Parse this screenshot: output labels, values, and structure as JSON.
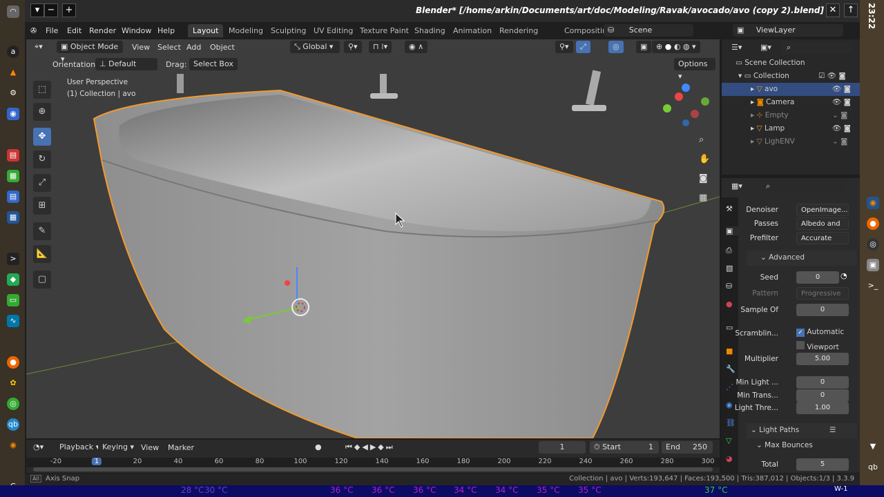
{
  "window": {
    "title": "Blender* [/home/arkin/Documents/art/doc/Modeling/Ravak/avocado/avo (copy 2).blend]",
    "clock": "23:22"
  },
  "menu": [
    "File",
    "Edit",
    "Render",
    "Window",
    "Help"
  ],
  "workspaces": [
    "Layout",
    "Modeling",
    "Sculpting",
    "UV Editing",
    "Texture Paint",
    "Shading",
    "Animation",
    "Rendering",
    "Compositing"
  ],
  "scene": {
    "label": "Scene",
    "view_layer": "ViewLayer"
  },
  "viewport_header": {
    "mode": "Object Mode",
    "menus": [
      "View",
      "Select",
      "Add",
      "Object"
    ],
    "transform": "Global",
    "orientation_label": "Orientation:",
    "orientation": "Default",
    "drag_label": "Drag:",
    "drag": "Select Box",
    "options": "Options"
  },
  "viewport": {
    "perspective": "User Perspective",
    "collection": "(1) Collection | avo"
  },
  "outliner": {
    "root": "Scene Collection",
    "collection": "Collection",
    "items": [
      "avo",
      "Camera",
      "Empty",
      "Lamp",
      "LighENV"
    ]
  },
  "properties": {
    "denoiser": {
      "label": "Denoiser",
      "value": "OpenImage..."
    },
    "passes": {
      "label": "Passes",
      "value": "Albedo and ..."
    },
    "prefilter": {
      "label": "Prefilter",
      "value": "Accurate"
    },
    "advanced": "Advanced",
    "seed": {
      "label": "Seed",
      "value": "0"
    },
    "pattern": {
      "label": "Pattern",
      "value": "Progressive ..."
    },
    "sample_offset": {
      "label": "Sample Of",
      "value": "0"
    },
    "scrambling": {
      "label": "Scramblin...",
      "automatic": "Automatic",
      "automatic_checked": true,
      "viewport": "Viewport",
      "viewport_checked": false
    },
    "multiplier": {
      "label": "Multiplier",
      "value": "5.00"
    },
    "min_light": {
      "label": "Min Light ...",
      "value": "0"
    },
    "min_trans": {
      "label": "Min Trans...",
      "value": "0"
    },
    "light_threshold": {
      "label": "Light Thre...",
      "value": "1.00"
    },
    "light_paths": "Light Paths",
    "max_bounces": "Max Bounces",
    "total": {
      "label": "Total",
      "value": "5"
    }
  },
  "timeline": {
    "menus": [
      "Playback",
      "Keying",
      "View",
      "Marker"
    ],
    "current_frame": "1",
    "start_label": "Start",
    "start": "1",
    "end_label": "End",
    "end": "250",
    "ticks": [
      "-20",
      "1",
      "20",
      "40",
      "60",
      "80",
      "100",
      "120",
      "140",
      "160",
      "180",
      "200",
      "220",
      "240",
      "260",
      "280",
      "300"
    ]
  },
  "statusbar": {
    "left": "Axis Snap",
    "right": "Collection | avo | Verts:193,647 | Faces:193,500 | Tris:387,012 | Objects:1/3 | 3.3.9"
  },
  "sysbar": {
    "temps": [
      "28 °C",
      "30 °C",
      "36 °C",
      "36 °C",
      "36 °C",
      "34 °C",
      "34 °C",
      "35 °C",
      "35 °C",
      "37 °C"
    ],
    "workspace": "W-1"
  },
  "colors": {
    "accent": "#4772b3",
    "selection_outline": "#f39a2e",
    "sysbar": "#0c0c64"
  }
}
